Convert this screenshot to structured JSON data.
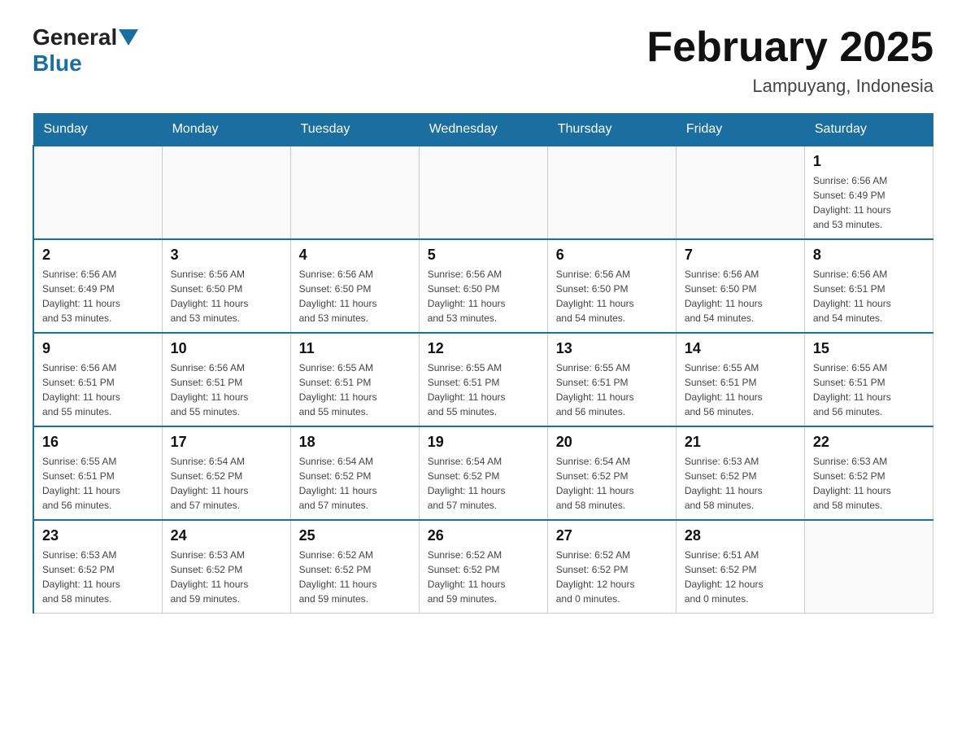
{
  "header": {
    "logo_general": "General",
    "logo_blue": "Blue",
    "month_title": "February 2025",
    "location": "Lampuyang, Indonesia"
  },
  "days_of_week": [
    "Sunday",
    "Monday",
    "Tuesday",
    "Wednesday",
    "Thursday",
    "Friday",
    "Saturday"
  ],
  "weeks": [
    [
      {
        "day": "",
        "info": ""
      },
      {
        "day": "",
        "info": ""
      },
      {
        "day": "",
        "info": ""
      },
      {
        "day": "",
        "info": ""
      },
      {
        "day": "",
        "info": ""
      },
      {
        "day": "",
        "info": ""
      },
      {
        "day": "1",
        "info": "Sunrise: 6:56 AM\nSunset: 6:49 PM\nDaylight: 11 hours\nand 53 minutes."
      }
    ],
    [
      {
        "day": "2",
        "info": "Sunrise: 6:56 AM\nSunset: 6:49 PM\nDaylight: 11 hours\nand 53 minutes."
      },
      {
        "day": "3",
        "info": "Sunrise: 6:56 AM\nSunset: 6:50 PM\nDaylight: 11 hours\nand 53 minutes."
      },
      {
        "day": "4",
        "info": "Sunrise: 6:56 AM\nSunset: 6:50 PM\nDaylight: 11 hours\nand 53 minutes."
      },
      {
        "day": "5",
        "info": "Sunrise: 6:56 AM\nSunset: 6:50 PM\nDaylight: 11 hours\nand 53 minutes."
      },
      {
        "day": "6",
        "info": "Sunrise: 6:56 AM\nSunset: 6:50 PM\nDaylight: 11 hours\nand 54 minutes."
      },
      {
        "day": "7",
        "info": "Sunrise: 6:56 AM\nSunset: 6:50 PM\nDaylight: 11 hours\nand 54 minutes."
      },
      {
        "day": "8",
        "info": "Sunrise: 6:56 AM\nSunset: 6:51 PM\nDaylight: 11 hours\nand 54 minutes."
      }
    ],
    [
      {
        "day": "9",
        "info": "Sunrise: 6:56 AM\nSunset: 6:51 PM\nDaylight: 11 hours\nand 55 minutes."
      },
      {
        "day": "10",
        "info": "Sunrise: 6:56 AM\nSunset: 6:51 PM\nDaylight: 11 hours\nand 55 minutes."
      },
      {
        "day": "11",
        "info": "Sunrise: 6:55 AM\nSunset: 6:51 PM\nDaylight: 11 hours\nand 55 minutes."
      },
      {
        "day": "12",
        "info": "Sunrise: 6:55 AM\nSunset: 6:51 PM\nDaylight: 11 hours\nand 55 minutes."
      },
      {
        "day": "13",
        "info": "Sunrise: 6:55 AM\nSunset: 6:51 PM\nDaylight: 11 hours\nand 56 minutes."
      },
      {
        "day": "14",
        "info": "Sunrise: 6:55 AM\nSunset: 6:51 PM\nDaylight: 11 hours\nand 56 minutes."
      },
      {
        "day": "15",
        "info": "Sunrise: 6:55 AM\nSunset: 6:51 PM\nDaylight: 11 hours\nand 56 minutes."
      }
    ],
    [
      {
        "day": "16",
        "info": "Sunrise: 6:55 AM\nSunset: 6:51 PM\nDaylight: 11 hours\nand 56 minutes."
      },
      {
        "day": "17",
        "info": "Sunrise: 6:54 AM\nSunset: 6:52 PM\nDaylight: 11 hours\nand 57 minutes."
      },
      {
        "day": "18",
        "info": "Sunrise: 6:54 AM\nSunset: 6:52 PM\nDaylight: 11 hours\nand 57 minutes."
      },
      {
        "day": "19",
        "info": "Sunrise: 6:54 AM\nSunset: 6:52 PM\nDaylight: 11 hours\nand 57 minutes."
      },
      {
        "day": "20",
        "info": "Sunrise: 6:54 AM\nSunset: 6:52 PM\nDaylight: 11 hours\nand 58 minutes."
      },
      {
        "day": "21",
        "info": "Sunrise: 6:53 AM\nSunset: 6:52 PM\nDaylight: 11 hours\nand 58 minutes."
      },
      {
        "day": "22",
        "info": "Sunrise: 6:53 AM\nSunset: 6:52 PM\nDaylight: 11 hours\nand 58 minutes."
      }
    ],
    [
      {
        "day": "23",
        "info": "Sunrise: 6:53 AM\nSunset: 6:52 PM\nDaylight: 11 hours\nand 58 minutes."
      },
      {
        "day": "24",
        "info": "Sunrise: 6:53 AM\nSunset: 6:52 PM\nDaylight: 11 hours\nand 59 minutes."
      },
      {
        "day": "25",
        "info": "Sunrise: 6:52 AM\nSunset: 6:52 PM\nDaylight: 11 hours\nand 59 minutes."
      },
      {
        "day": "26",
        "info": "Sunrise: 6:52 AM\nSunset: 6:52 PM\nDaylight: 11 hours\nand 59 minutes."
      },
      {
        "day": "27",
        "info": "Sunrise: 6:52 AM\nSunset: 6:52 PM\nDaylight: 12 hours\nand 0 minutes."
      },
      {
        "day": "28",
        "info": "Sunrise: 6:51 AM\nSunset: 6:52 PM\nDaylight: 12 hours\nand 0 minutes."
      },
      {
        "day": "",
        "info": ""
      }
    ]
  ]
}
